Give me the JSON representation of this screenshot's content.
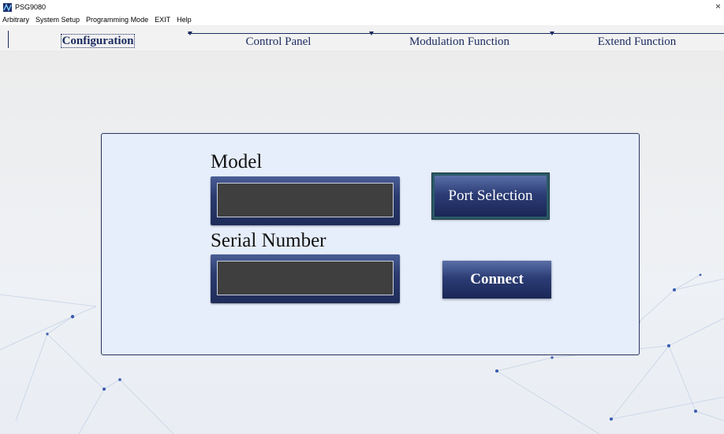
{
  "window": {
    "title": "PSG9080",
    "close_glyph": "×"
  },
  "menu": {
    "items": [
      "Arbitrary",
      "System Setup",
      "Programming Mode",
      "EXIT",
      "Help"
    ]
  },
  "tabs": [
    {
      "label": "Configuration",
      "active": true
    },
    {
      "label": "Control Panel",
      "active": false
    },
    {
      "label": "Modulation Function",
      "active": false
    },
    {
      "label": "Extend Function",
      "active": false
    }
  ],
  "config": {
    "model_label": "Model",
    "model_value": "",
    "serial_label": "Serial Number",
    "serial_value": "",
    "port_button": "Port Selection",
    "connect_button": "Connect"
  },
  "colors": {
    "accent": "#1a2a5e",
    "panel_bg": "#e6eefb",
    "field_bg": "#3f3f3f"
  }
}
